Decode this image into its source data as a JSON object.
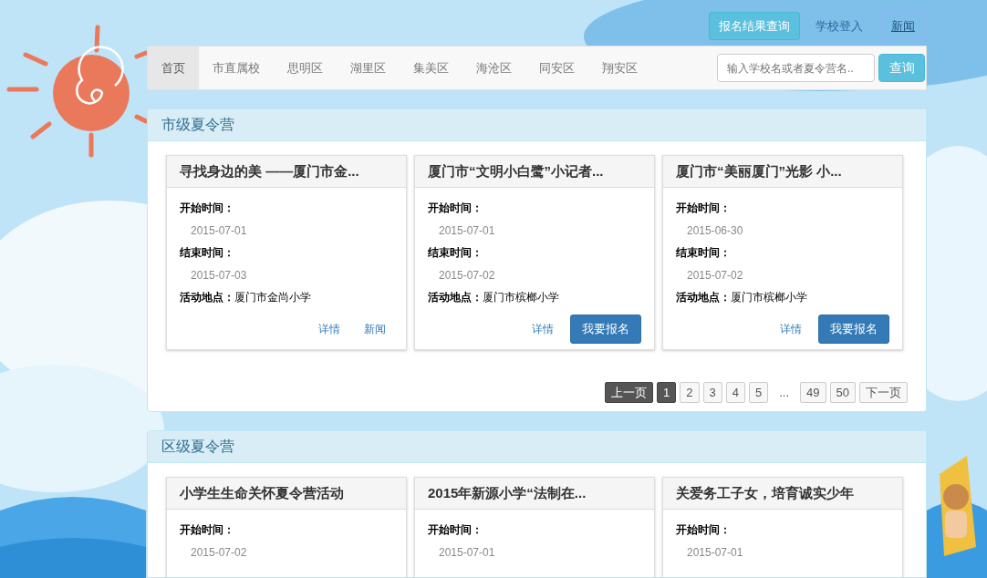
{
  "top_links": [
    {
      "label": "报名结果查询",
      "kind": "button"
    },
    {
      "label": "学校登入",
      "kind": "link"
    },
    {
      "label": "新闻",
      "kind": "outlined"
    }
  ],
  "nav": {
    "items": [
      {
        "label": "首页",
        "selected": true
      },
      {
        "label": "市直属校",
        "selected": false
      },
      {
        "label": "思明区",
        "selected": false
      },
      {
        "label": "湖里区",
        "selected": false
      },
      {
        "label": "集美区",
        "selected": false
      },
      {
        "label": "海沧区",
        "selected": false
      },
      {
        "label": "同安区",
        "selected": false
      },
      {
        "label": "翔安区",
        "selected": false
      }
    ],
    "search": {
      "placeholder": "输入学校名或者夏令营名..",
      "button": "查询"
    }
  },
  "sections": [
    {
      "title": "市级夏令营",
      "cards": [
        {
          "title": "寻找身边的美 ——厦门市金...",
          "start_label": "开始时间：",
          "start": "2015-07-01",
          "end_label": "结束时间：",
          "end": "2015-07-03",
          "location_label": "活动地点：",
          "location": "厦门市金尚小学",
          "actions": [
            {
              "label": "详情",
              "kind": "link"
            },
            {
              "label": "新闻",
              "kind": "link"
            }
          ]
        },
        {
          "title": "厦门市“文明小白鹭”小记者...",
          "start_label": "开始时间：",
          "start": "2015-07-01",
          "end_label": "结束时间：",
          "end": "2015-07-02",
          "location_label": "活动地点：",
          "location": "厦门市槟榔小学",
          "actions": [
            {
              "label": "详情",
              "kind": "link"
            },
            {
              "label": "我要报名",
              "kind": "button"
            }
          ]
        },
        {
          "title": "厦门市“美丽厦门”光影 小...",
          "start_label": "开始时间：",
          "start": "2015-06-30",
          "end_label": "结束时间：",
          "end": "2015-07-02",
          "location_label": "活动地点：",
          "location": "厦门市槟榔小学",
          "actions": [
            {
              "label": "详情",
              "kind": "link"
            },
            {
              "label": "我要报名",
              "kind": "button"
            }
          ]
        }
      ],
      "pagination": [
        {
          "label": "上一页",
          "kind": "prev",
          "disabled": true
        },
        {
          "label": "1",
          "kind": "page",
          "selected": true
        },
        {
          "label": "2",
          "kind": "page",
          "selected": false
        },
        {
          "label": "3",
          "kind": "page",
          "selected": false
        },
        {
          "label": "4",
          "kind": "page",
          "selected": false
        },
        {
          "label": "5",
          "kind": "page",
          "selected": false
        },
        {
          "label": "...",
          "kind": "gap"
        },
        {
          "label": "49",
          "kind": "page",
          "selected": false
        },
        {
          "label": "50",
          "kind": "page",
          "selected": false
        },
        {
          "label": "下一页",
          "kind": "next",
          "disabled": false
        }
      ]
    },
    {
      "title": "区级夏令营",
      "cards": [
        {
          "title": "小学生生命关怀夏令营活动",
          "start_label": "开始时间：",
          "start": "2015-07-02"
        },
        {
          "title": "2015年新源小学“法制在...",
          "start_label": "开始时间：",
          "start": "2015-07-01"
        },
        {
          "title": "关爱务工子女，培育诚实少年",
          "start_label": "开始时间：",
          "start": "2015-07-01"
        }
      ]
    }
  ]
}
